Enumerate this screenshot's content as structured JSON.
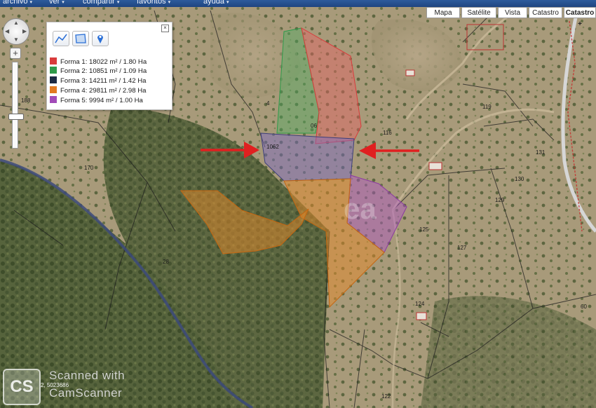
{
  "menu": {
    "items": [
      {
        "label": "archivo",
        "caret": "▾"
      },
      {
        "label": "ver",
        "caret": "▾"
      },
      {
        "label": "compartir",
        "caret": "▾"
      },
      {
        "label": "favoritos",
        "caret": "▾"
      },
      {
        "label": "ayuda",
        "caret": "▾"
      }
    ]
  },
  "map_types": {
    "mapa": "Mapa",
    "satelite": "Satélite",
    "vista": "Vista",
    "catastro": "Catastro",
    "catastro_plus": "Catastro +"
  },
  "nav": {
    "zoom_in": "+",
    "zoom_out": "−",
    "zoom_level_fraction": 0.62
  },
  "legend": {
    "close": "×",
    "tools": [
      {
        "icon": "polyline-tool-icon"
      },
      {
        "icon": "polygon-tool-icon"
      },
      {
        "icon": "marker-tool-icon"
      }
    ],
    "shapes": [
      {
        "label": "Forma 1: 18022 m² / 1.80 Ha",
        "color": "#d93b3b"
      },
      {
        "label": "Forma 2: 10851 m² / 1.09 Ha",
        "color": "#2f9a4a"
      },
      {
        "label": "Forma 3: 14211 m² / 1.42 Ha",
        "color": "#1c2a44"
      },
      {
        "label": "Forma 4: 29811 m² / 2.98 Ha",
        "color": "#e17a22"
      },
      {
        "label": "Forma 5: 9994 m² / 1.00 Ha",
        "color": "#a24bb8"
      }
    ]
  },
  "parcels": {
    "labels": [
      "188",
      "170",
      "119",
      "116",
      "131",
      "129",
      "130",
      "125",
      "127",
      "124",
      "122",
      "4",
      "28",
      "60"
    ],
    "partial_labels": [
      "06",
      "1062"
    ]
  },
  "overlay": {
    "watermark_small": "ea",
    "coordinates": "2, 5023686"
  },
  "watermark": {
    "logo_text": "CS",
    "line1": "Scanned with",
    "line2": "CamScanner"
  },
  "colors": {
    "forma1": "#d93b3b",
    "forma2": "#2f9a4a",
    "forma3": "#6a5fb8",
    "forma4": "#e17a22",
    "forma5": "#a24bb8",
    "arrow": "#e02020",
    "menubar": "#2d5b9c"
  }
}
